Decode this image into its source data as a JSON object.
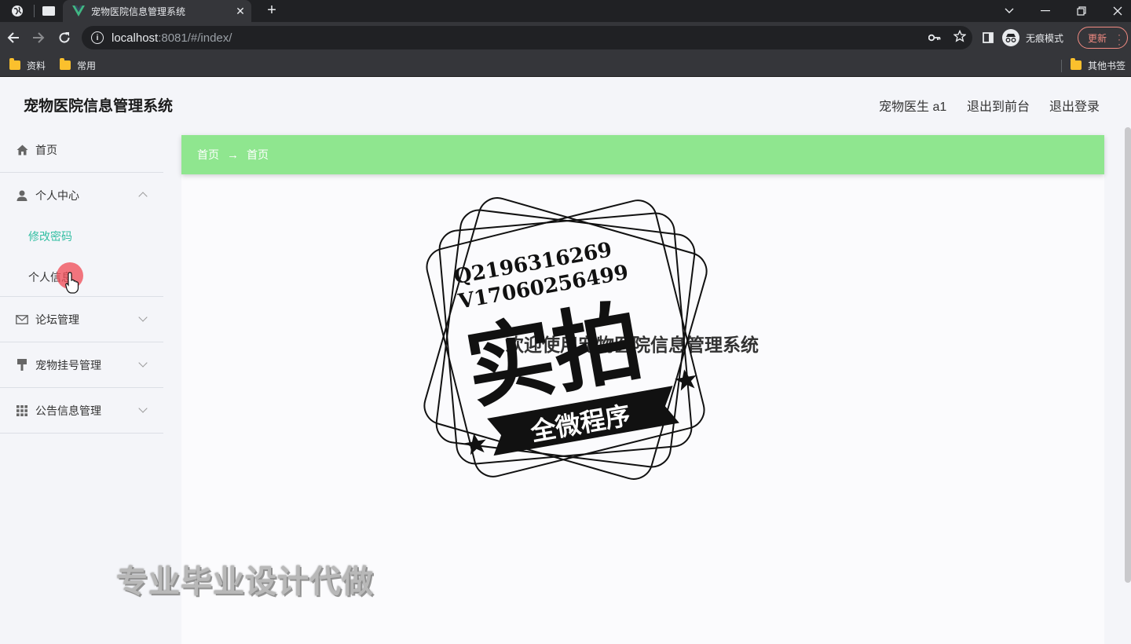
{
  "browser": {
    "tab_title": "宠物医院信息管理系统",
    "tab_close": "✕",
    "new_tab": "+",
    "url_host": "localhost",
    "url_rest": ":8081/#/index/",
    "profile_label": "无痕模式",
    "update_label": "更新",
    "bookmarks": [
      "资料",
      "常用"
    ],
    "other_bookmarks": "其他书签",
    "icons": {
      "back": "arrow-left-icon",
      "forward": "arrow-right-icon",
      "reload": "reload-icon",
      "info": "info-icon",
      "key": "key-icon",
      "star": "star-icon",
      "sidepanel": "side-panel-icon"
    }
  },
  "app": {
    "title": "宠物医院信息管理系统",
    "header_links": {
      "user": "宠物医生 a1",
      "front": "退出到前台",
      "logout": "退出登录"
    },
    "menu": {
      "home": "首页",
      "personal_center": "个人中心",
      "change_password": "修改密码",
      "personal_info": "个人信息",
      "forum": "论坛管理",
      "pet_registration": "宠物挂号管理",
      "notice": "公告信息管理"
    },
    "breadcrumb": {
      "first": "首页",
      "separator": "→",
      "second": "首页"
    },
    "welcome": "欢迎使用宠物医院信息管理系统",
    "active_color": "#34bfa3",
    "breadcrumb_color": "#8fe68f"
  },
  "overlay": {
    "stamp_lines": [
      "Q2196316269",
      "V17060256499"
    ],
    "stamp_main": "实拍",
    "stamp_banner": "全微程序",
    "watermark": "专业毕业设计代做"
  }
}
